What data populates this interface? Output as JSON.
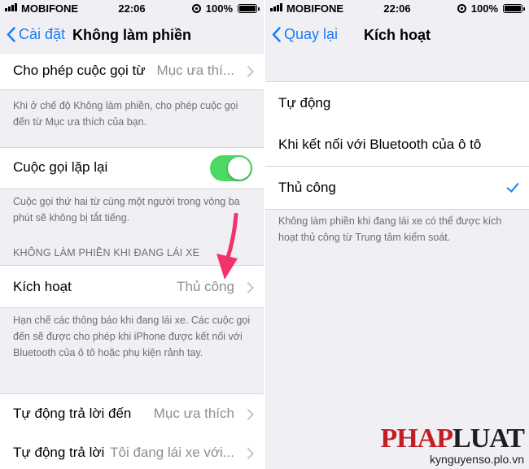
{
  "status": {
    "carrier": "MOBIFONE",
    "time": "22:06",
    "battery": "100%"
  },
  "left": {
    "nav": {
      "back": "Cài đặt",
      "title": "Không làm phiền"
    },
    "allow_calls": {
      "label": "Cho phép cuộc gọi từ",
      "value": "Mục ưa thí..."
    },
    "allow_calls_footer": "Khi ở chế độ Không làm phiền, cho phép cuộc gọi đến từ Mục ưa thích của bạn.",
    "repeated_calls": {
      "label": "Cuộc gọi lặp lại",
      "on": true
    },
    "repeated_calls_footer": "Cuộc gọi thứ hai từ cùng một người trong vòng ba phút sẽ không bị tắt tiếng.",
    "driving_header": "KHÔNG LÀM PHIỀN KHI ĐANG LÁI XE",
    "activate": {
      "label": "Kích hoạt",
      "value": "Thủ công"
    },
    "activate_footer": "Hạn chế các thông báo khi đang lái xe. Các cuộc gọi đến sẽ được cho phép khi iPhone được kết nối với Bluetooth của ô tô hoặc phụ kiện rảnh tay.",
    "auto_reply_to": {
      "label": "Tự động trả lời đến",
      "value": "Mục ưa thích"
    },
    "auto_reply": {
      "label": "Tự động trả lời",
      "value": "Tôi đang lái xe với..."
    }
  },
  "right": {
    "nav": {
      "back": "Quay lại",
      "title": "Kích hoạt"
    },
    "options": [
      {
        "label": "Tự động",
        "selected": false
      },
      {
        "label": "Khi kết nối với Bluetooth của ô tô",
        "selected": false
      },
      {
        "label": "Thủ công",
        "selected": true
      }
    ],
    "footer": "Không làm phiền khi đang lái xe có thể được kích hoạt thủ công từ Trung tâm kiểm soát."
  },
  "watermark": {
    "logo_a": "PHAP",
    "logo_b": "LUAT",
    "url": "kynguyenso.plo.vn"
  },
  "colors": {
    "accent": "#1a7cf6",
    "toggle_on": "#4cd964",
    "arrow": "#f2336b"
  }
}
